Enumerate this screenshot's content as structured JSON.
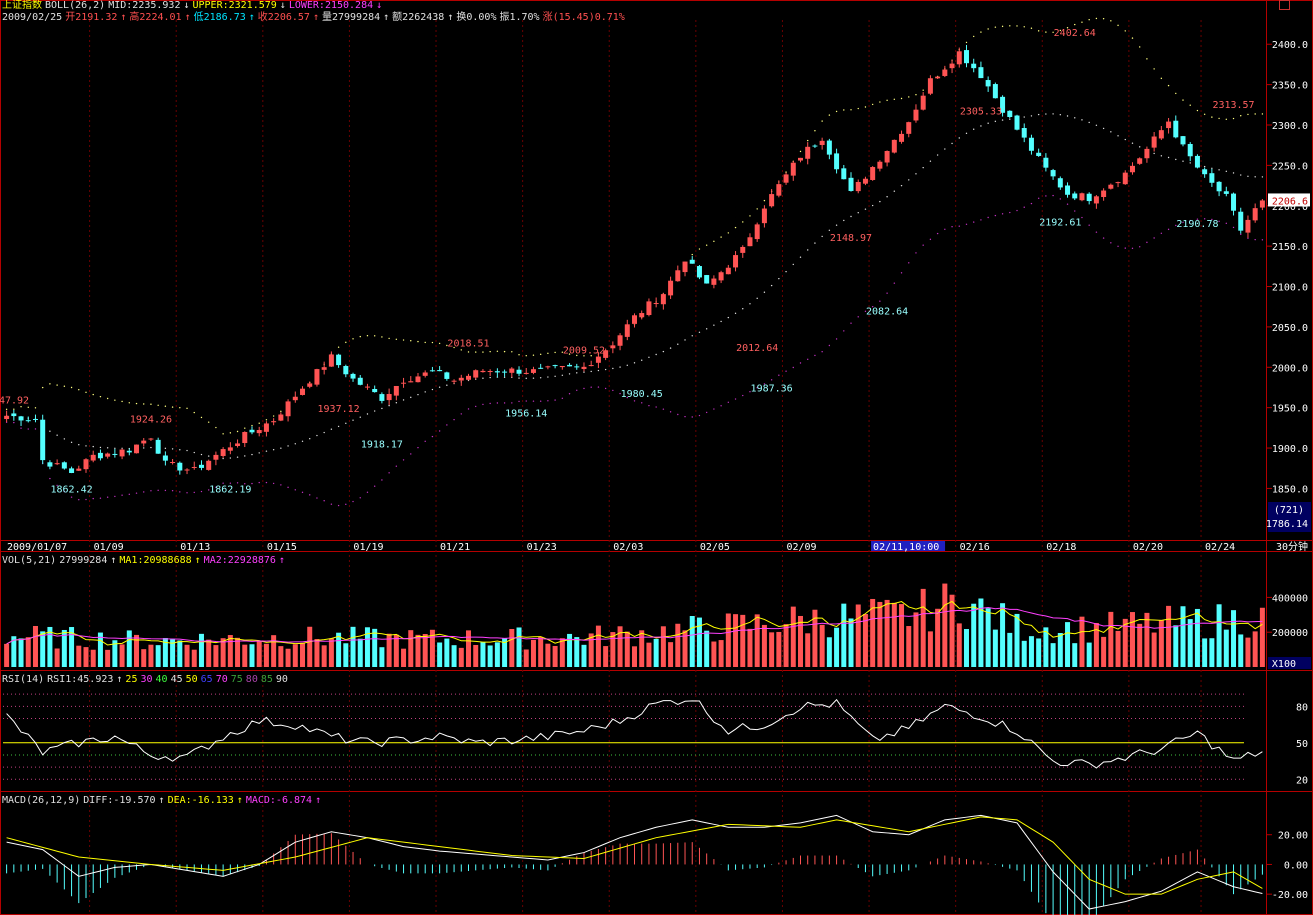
{
  "header": {
    "index_name": "上证指数",
    "boll_label": "BOLL(26,2)",
    "mid": "MID:2235.932",
    "upper": "UPPER:2321.579",
    "lower": "LOWER:2150.284",
    "arrow_down": "↓",
    "arrow_up": "↑",
    "date": "2009/02/25",
    "open": "开2191.32",
    "high": "高2224.01",
    "low": "低2186.73",
    "close": "收2206.57",
    "volume": "量27999284",
    "amount": "额2262438",
    "turnover": "换0.00%",
    "amplitude": "振1.70%",
    "change": "涨(15.45)0.71%"
  },
  "vol_header": {
    "label": "VOL(5,21)",
    "vol": "27999284",
    "ma1": "MA1:20988688",
    "ma2": "MA2:22928876"
  },
  "rsi_header": {
    "label": "RSI(14)",
    "rsi1": "RSI1:45.923",
    "lv": [
      "25",
      "30",
      "40",
      "45",
      "50",
      "65",
      "70",
      "75",
      "80",
      "85",
      "90"
    ]
  },
  "macd_header": {
    "label": "MACD(26,12,9)",
    "diff": "DIFF:-19.570",
    "dea": "DEA:-16.133",
    "macd": "MACD:-6.874"
  },
  "price_axis": {
    "labels": [
      "2400.0",
      "2350.0",
      "2300.0",
      "2250.0",
      "2200.0",
      "2150.0",
      "2100.0",
      "2050.0",
      "2000.0",
      "1950.0",
      "1900.0",
      "1850.0"
    ],
    "current_price_tag": "2206.6",
    "low_info_1": "(721)",
    "low_info_2": "1786.14"
  },
  "date_axis": {
    "labels": [
      "2009/01/07",
      "01/09",
      "01/13",
      "01/15",
      "01/19",
      "01/21",
      "01/23",
      "02/03",
      "02/05",
      "02/09",
      "02/11,10:00",
      "02/16",
      "02/18",
      "02/20",
      "02/24"
    ],
    "period": "30分钟"
  },
  "vol_axis": {
    "labels": [
      "400000",
      "200000"
    ],
    "unit": "X100"
  },
  "rsi_axis": {
    "labels": [
      "80",
      "50",
      "20"
    ]
  },
  "macd_axis": {
    "labels": [
      "20.00",
      "0.00",
      "-20.00"
    ]
  },
  "colors": {
    "up": "#ff5454",
    "down": "#54ffff",
    "axis": "#b40000",
    "upper": "#ffff80",
    "lower": "#c030c0",
    "mid": "#e0e0e0"
  },
  "chart_data": {
    "type": "candlestick",
    "title": "上证指数 30分钟 K线",
    "ylim": [
      1786.14,
      2430
    ],
    "annotations": [
      {
        "text": "47.92",
        "type": "high",
        "price": 1947.92
      },
      {
        "text": "1862.42",
        "type": "low",
        "price": 1862.42
      },
      {
        "text": "1924.26",
        "type": "high",
        "price": 1924.26
      },
      {
        "text": "1862.19",
        "type": "low",
        "price": 1862.19
      },
      {
        "text": "1937.12",
        "type": "high",
        "price": 1937.12
      },
      {
        "text": "1918.17",
        "type": "low",
        "price": 1918.17
      },
      {
        "text": "2018.51",
        "type": "high",
        "price": 2018.51
      },
      {
        "text": "1956.14",
        "type": "low",
        "price": 1956.14
      },
      {
        "text": "2009.52",
        "type": "high",
        "price": 2009.52
      },
      {
        "text": "1980.45",
        "type": "low",
        "price": 1980.45
      },
      {
        "text": "2012.64",
        "type": "high",
        "price": 2012.64
      },
      {
        "text": "1987.36",
        "type": "low",
        "price": 1987.36
      },
      {
        "text": "2148.97",
        "type": "high",
        "price": 2148.97
      },
      {
        "text": "2082.64",
        "type": "low",
        "price": 2082.64
      },
      {
        "text": "2305.33",
        "type": "high",
        "price": 2305.33
      },
      {
        "text": "2192.61",
        "type": "low",
        "price": 2192.61
      },
      {
        "text": "2402.64",
        "type": "high",
        "price": 2402.64
      },
      {
        "text": "2190.78",
        "type": "low",
        "price": 2190.78
      },
      {
        "text": "2313.57",
        "type": "high",
        "price": 2313.57
      }
    ],
    "close_path": [
      [
        0,
        1940
      ],
      [
        4,
        1936
      ],
      [
        5,
        1885
      ],
      [
        9,
        1870
      ],
      [
        12,
        1890
      ],
      [
        17,
        1898
      ],
      [
        20,
        1915
      ],
      [
        22,
        1880
      ],
      [
        26,
        1872
      ],
      [
        28,
        1885
      ],
      [
        33,
        1915
      ],
      [
        37,
        1935
      ],
      [
        41,
        1975
      ],
      [
        45,
        2012
      ],
      [
        48,
        1985
      ],
      [
        52,
        1962
      ],
      [
        55,
        1985
      ],
      [
        59,
        1994
      ],
      [
        62,
        1984
      ],
      [
        66,
        1996
      ],
      [
        70,
        1996
      ],
      [
        73,
        1995
      ],
      [
        77,
        1998
      ],
      [
        80,
        2000
      ],
      [
        84,
        2030
      ],
      [
        87,
        2062
      ],
      [
        91,
        2092
      ],
      [
        94,
        2135
      ],
      [
        97,
        2100
      ],
      [
        102,
        2145
      ],
      [
        105,
        2200
      ],
      [
        110,
        2262
      ],
      [
        113,
        2285
      ],
      [
        115,
        2250
      ],
      [
        117,
        2215
      ],
      [
        122,
        2270
      ],
      [
        125,
        2305
      ],
      [
        128,
        2355
      ],
      [
        130,
        2372
      ],
      [
        132,
        2390
      ],
      [
        135,
        2362
      ],
      [
        138,
        2320
      ],
      [
        141,
        2282
      ],
      [
        144,
        2245
      ],
      [
        147,
        2215
      ],
      [
        150,
        2210
      ],
      [
        152,
        2222
      ],
      [
        155,
        2240
      ],
      [
        158,
        2270
      ],
      [
        161,
        2305
      ],
      [
        163,
        2272
      ],
      [
        166,
        2235
      ],
      [
        169,
        2210
      ],
      [
        171,
        2170
      ],
      [
        173,
        2195
      ],
      [
        174,
        2206.57
      ]
    ],
    "volume_path": [
      [
        0,
        180000
      ],
      [
        20,
        150000
      ],
      [
        40,
        170000
      ],
      [
        60,
        160000
      ],
      [
        80,
        170000
      ],
      [
        100,
        230000
      ],
      [
        110,
        270000
      ],
      [
        125,
        300000
      ],
      [
        132,
        380000
      ],
      [
        140,
        230000
      ],
      [
        150,
        220000
      ],
      [
        160,
        250000
      ],
      [
        174,
        280000
      ]
    ],
    "rsi_path": [
      [
        0,
        72
      ],
      [
        5,
        42
      ],
      [
        10,
        50
      ],
      [
        15,
        55
      ],
      [
        20,
        40
      ],
      [
        25,
        38
      ],
      [
        30,
        55
      ],
      [
        35,
        68
      ],
      [
        40,
        65
      ],
      [
        45,
        55
      ],
      [
        50,
        50
      ],
      [
        55,
        52
      ],
      [
        60,
        55
      ],
      [
        65,
        50
      ],
      [
        70,
        52
      ],
      [
        75,
        55
      ],
      [
        80,
        60
      ],
      [
        85,
        68
      ],
      [
        90,
        82
      ],
      [
        95,
        87
      ],
      [
        100,
        60
      ],
      [
        105,
        65
      ],
      [
        110,
        80
      ],
      [
        115,
        82
      ],
      [
        120,
        52
      ],
      [
        125,
        62
      ],
      [
        130,
        80
      ],
      [
        135,
        72
      ],
      [
        140,
        60
      ],
      [
        145,
        35
      ],
      [
        150,
        32
      ],
      [
        155,
        38
      ],
      [
        160,
        45
      ],
      [
        165,
        58
      ],
      [
        170,
        35
      ],
      [
        174,
        43
      ]
    ],
    "macd_diff": [
      [
        0,
        15
      ],
      [
        5,
        10
      ],
      [
        10,
        -8
      ],
      [
        15,
        -2
      ],
      [
        20,
        0
      ],
      [
        25,
        -4
      ],
      [
        30,
        -8
      ],
      [
        35,
        0
      ],
      [
        40,
        15
      ],
      [
        45,
        22
      ],
      [
        50,
        18
      ],
      [
        55,
        12
      ],
      [
        60,
        9
      ],
      [
        65,
        7
      ],
      [
        70,
        5
      ],
      [
        75,
        3
      ],
      [
        80,
        8
      ],
      [
        85,
        18
      ],
      [
        90,
        25
      ],
      [
        95,
        30
      ],
      [
        100,
        25
      ],
      [
        105,
        25
      ],
      [
        110,
        28
      ],
      [
        115,
        33
      ],
      [
        120,
        22
      ],
      [
        125,
        20
      ],
      [
        130,
        30
      ],
      [
        135,
        33
      ],
      [
        140,
        28
      ],
      [
        145,
        -5
      ],
      [
        150,
        -30
      ],
      [
        155,
        -25
      ],
      [
        160,
        -18
      ],
      [
        165,
        -5
      ],
      [
        170,
        -15
      ],
      [
        174,
        -19.57
      ]
    ],
    "macd_dea": [
      [
        0,
        18
      ],
      [
        10,
        5
      ],
      [
        20,
        0
      ],
      [
        30,
        -4
      ],
      [
        40,
        5
      ],
      [
        50,
        18
      ],
      [
        60,
        12
      ],
      [
        70,
        6
      ],
      [
        80,
        4
      ],
      [
        90,
        18
      ],
      [
        100,
        27
      ],
      [
        110,
        25
      ],
      [
        115,
        30
      ],
      [
        125,
        22
      ],
      [
        135,
        32
      ],
      [
        140,
        30
      ],
      [
        145,
        15
      ],
      [
        150,
        -10
      ],
      [
        155,
        -20
      ],
      [
        160,
        -20
      ],
      [
        165,
        -10
      ],
      [
        170,
        -5
      ],
      [
        174,
        -16.133
      ]
    ]
  }
}
